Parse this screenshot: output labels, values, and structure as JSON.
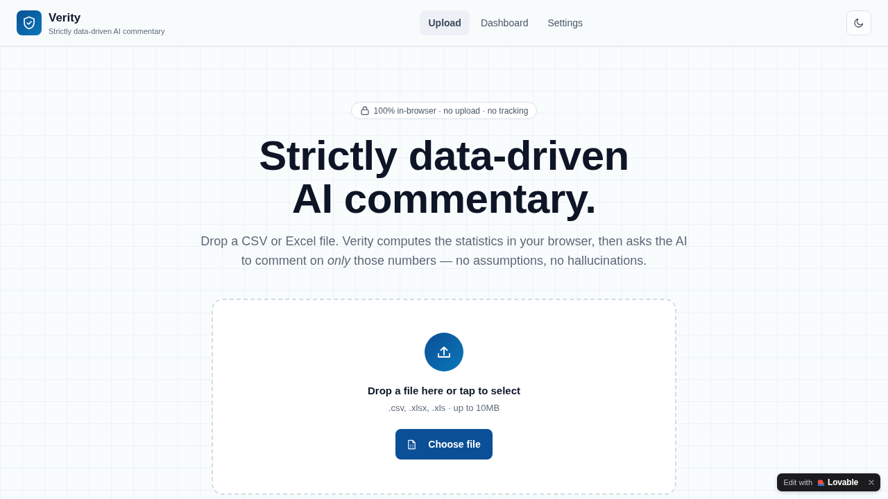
{
  "header": {
    "app_title": "Verity",
    "app_tagline": "Strictly data-driven AI commentary",
    "nav": [
      {
        "label": "Upload",
        "selected": true
      },
      {
        "label": "Dashboard",
        "selected": false
      },
      {
        "label": "Settings",
        "selected": false
      }
    ]
  },
  "hero": {
    "badge": "100% in-browser · no upload · no tracking",
    "headline": "Strictly data-driven AI commentary.",
    "description": "Drop a CSV or Excel file. Verity computes the statistics in your browser, then asks the AI to comment on *only* those numbers — no assumptions, no hallucinations."
  },
  "dropzone": {
    "title": "Drop a file here or tap to select",
    "hint": ".csv, .xlsx, .xls · up to 10MB",
    "button": "Choose file"
  },
  "edit_badge": {
    "prefix": "Edit with",
    "brand": "Lovable"
  }
}
